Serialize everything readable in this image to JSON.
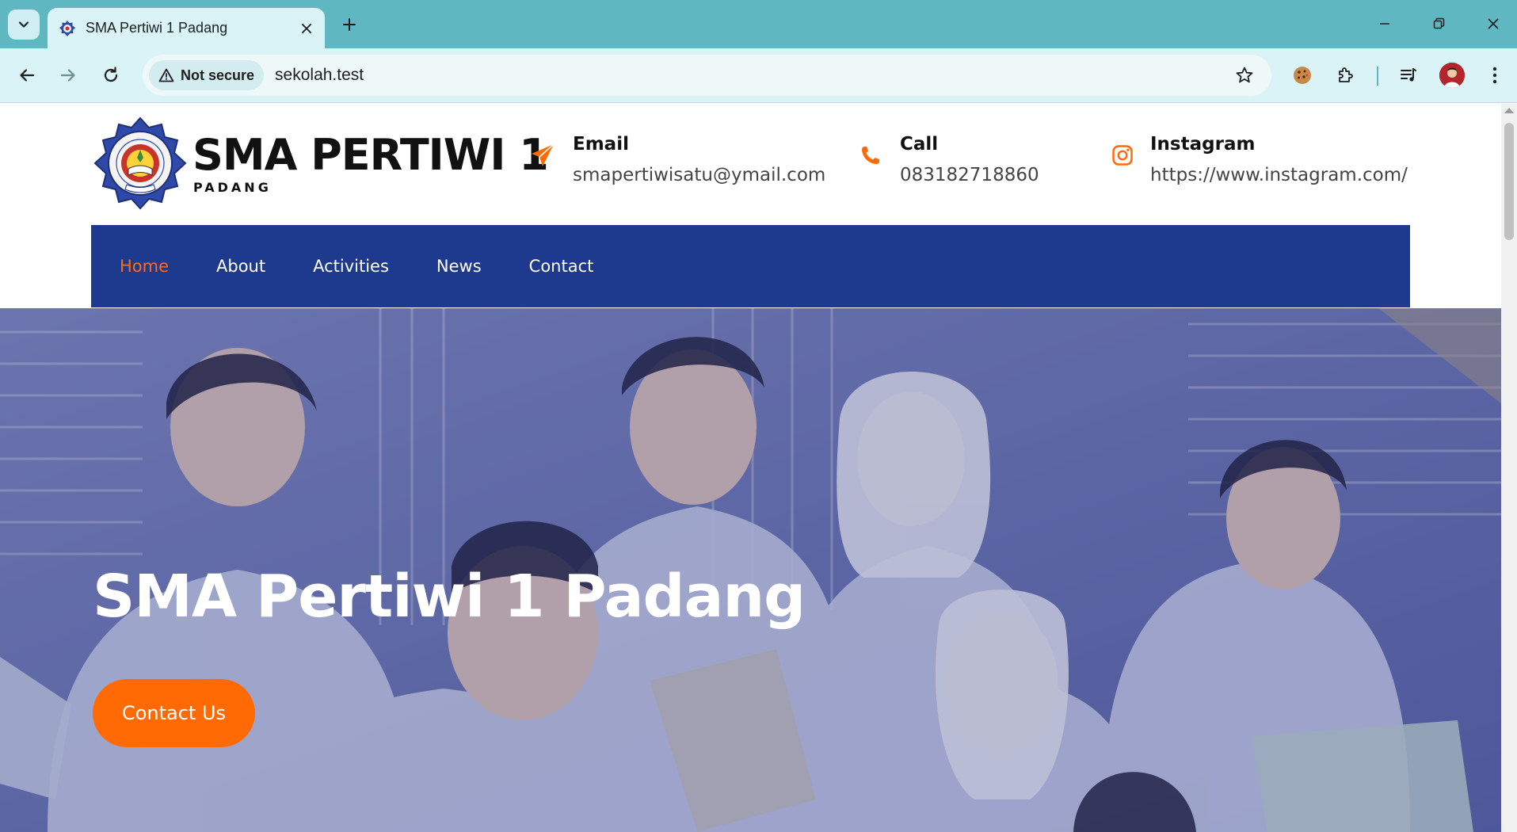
{
  "browser": {
    "tab_title": "SMA Pertiwi 1 Padang",
    "security_label": "Not secure",
    "url": "sekolah.test",
    "theme_color": "#5fb7c2"
  },
  "site": {
    "logo_title": "SMA PERTIWI 1",
    "logo_subtitle": "PADANG",
    "contacts": [
      {
        "label": "Email",
        "value": "smapertiwisatu@ymail.com",
        "icon": "paper-plane-icon"
      },
      {
        "label": "Call",
        "value": "083182718860",
        "icon": "phone-icon"
      },
      {
        "label": "Instagram",
        "value": "https://www.instagram.com/",
        "icon": "instagram-icon"
      }
    ],
    "nav": [
      {
        "label": "Home",
        "active": true
      },
      {
        "label": "About"
      },
      {
        "label": "Activities"
      },
      {
        "label": "News"
      },
      {
        "label": "Contact"
      }
    ],
    "hero": {
      "title": "SMA Pertiwi 1 Padang",
      "button_label": "Contact Us"
    },
    "colors": {
      "nav_bg": "#1e3a8f",
      "accent": "#ff6a05"
    }
  }
}
